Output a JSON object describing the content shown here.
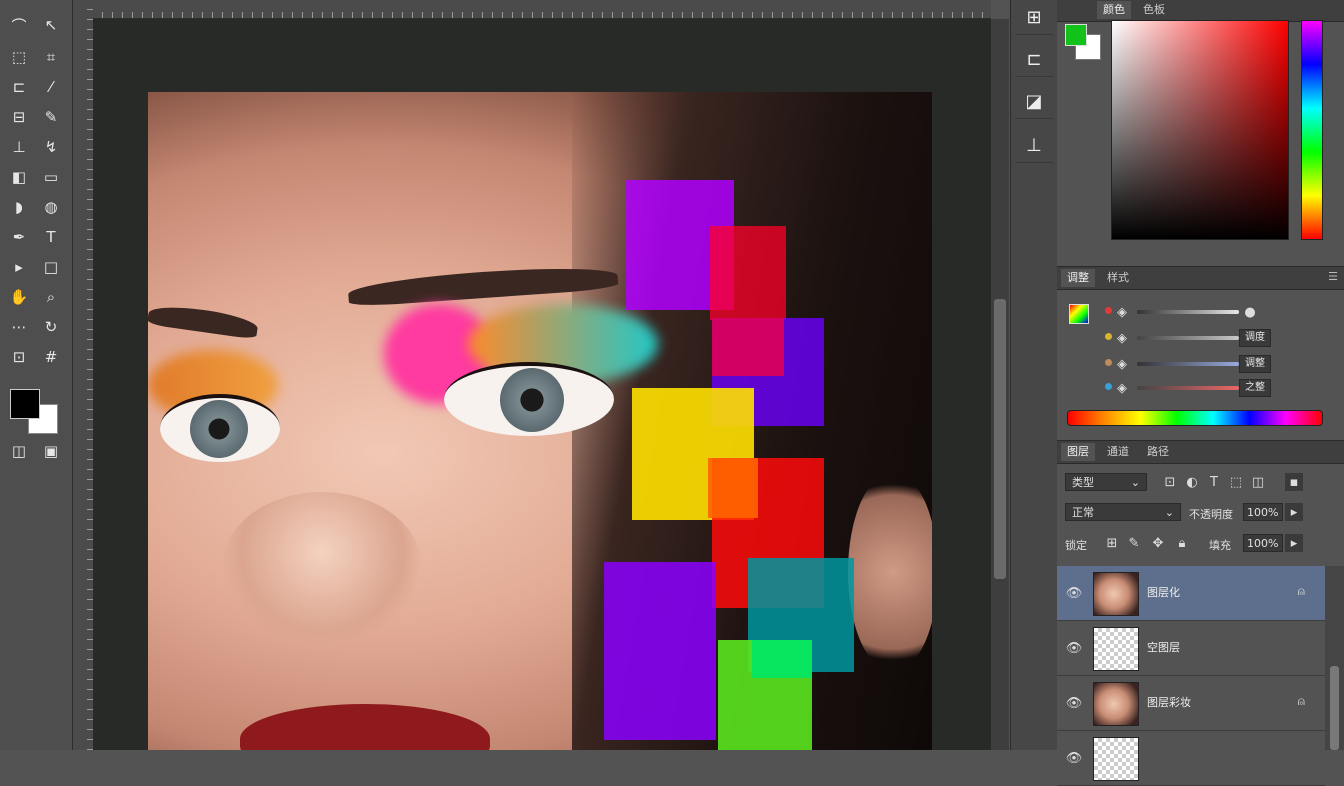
{
  "app": {
    "icons": {
      "toolbar": [
        "lasso-icon",
        "magic-wand-icon",
        "marquee-icon",
        "crop-icon",
        "slice-icon",
        "eyedropper-icon",
        "heal-icon",
        "brush-icon",
        "clone-stamp-icon",
        "history-brush-icon",
        "eraser-icon",
        "gradient-icon",
        "blur-icon",
        "dodge-icon",
        "pen-icon",
        "type-icon",
        "path-select-icon",
        "shape-icon",
        "hand-icon",
        "zoom-icon"
      ],
      "strip": [
        "history-panel-icon",
        "properties-panel-icon",
        "adjustments-panel-icon",
        "styles-panel-icon"
      ]
    }
  },
  "colors": {
    "foreground": "#000000",
    "background": "#ffffff",
    "picker_foreground": "#12c21a",
    "picker_hue": "#ff0000",
    "layer_selected": "#5d6f8c"
  },
  "color_panel": {
    "tabs": [
      "颜色",
      "色板"
    ]
  },
  "adjust_panel": {
    "tabs": [
      "调整",
      "样式"
    ],
    "rows": [
      {
        "dot_color": "#e03a3a",
        "value": ""
      },
      {
        "dot_color": "#d9b52e",
        "value": "调度"
      },
      {
        "dot_color": "#c08a5a",
        "value": "调整"
      },
      {
        "dot_color": "#3aa0d9",
        "value": "之整"
      }
    ]
  },
  "layers_panel": {
    "tabs": [
      "图层",
      "通道",
      "路径"
    ],
    "filter_label": "类型",
    "blend_mode": "正常",
    "opacity_label": "不透明度",
    "opacity_value": "100%",
    "lock_label": "锁定",
    "fill_label": "填充",
    "fill_value": "100%",
    "layers": [
      {
        "name": "图层化",
        "thumb": "face",
        "selected": true,
        "locked": true
      },
      {
        "name": "空图层",
        "thumb": "transparent",
        "selected": false,
        "locked": false
      },
      {
        "name": "图层彩妆",
        "thumb": "face",
        "selected": false,
        "locked": true
      },
      {
        "name": "",
        "thumb": "transparent",
        "selected": false,
        "locked": false
      }
    ]
  }
}
